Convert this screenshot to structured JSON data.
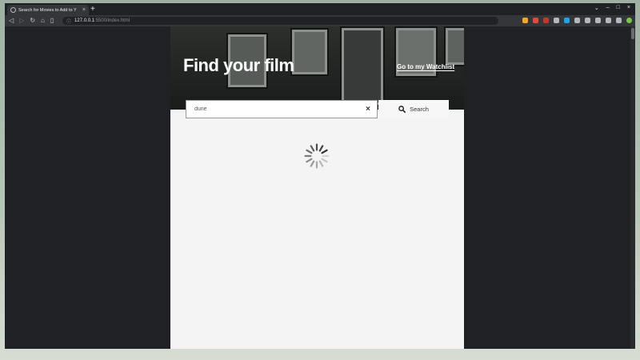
{
  "browser": {
    "tab_title": "Search for Movies to Add to Y",
    "tab_close": "×",
    "new_tab": "+",
    "url_host": "127.0.0.1",
    "url_rest": ":5500/index.html",
    "window_controls": [
      "⌄",
      "–",
      "□",
      "×"
    ]
  },
  "page": {
    "heading": "Find your film",
    "watchlist_link": "Go to my Watchlist",
    "search": {
      "value": "dune",
      "clear": "×",
      "button_label": "Search"
    }
  },
  "colors": {
    "accent_ext": [
      "#f6a623",
      "#e24a3b",
      "#c0392b",
      "#b4b8bd",
      "#1ea4e9",
      "#b4b8bd",
      "#b4b8bd",
      "#b4b8bd",
      "#b4b8bd",
      "#b4b8bd",
      "#7ac943"
    ]
  }
}
